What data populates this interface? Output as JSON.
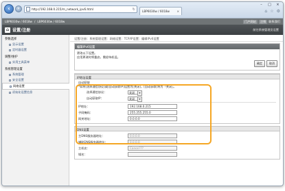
{
  "browser": {
    "url": "http://192.168.0.215/m_network_ipv6.html",
    "tab_title": "LBP6030w / 6018w",
    "controls": [
      "–",
      "□",
      "×"
    ]
  },
  "header": {
    "model": "LBP6030w / 6018w",
    "model2": "LBP6030w / 6018w",
    "right_links": [
      "门户网站",
      "注销",
      "联系我们"
    ],
    "title": "设置/注册",
    "settings_link": "前往系统管理员设置"
  },
  "sidebar": {
    "sections": [
      {
        "label": "参数选择",
        "items": [
          "显示设置",
          "定时器设置"
        ]
      },
      {
        "label": "调整/维护",
        "items": [
          "实用工具菜单"
        ]
      },
      {
        "label": "系统管理设置",
        "items": [
          "系统管理",
          "安全设置",
          "网络设置",
          "初始化设置信息"
        ]
      }
    ],
    "active_item": "网络设置"
  },
  "breadcrumb": "设置/注册：系统管理设置：网络设置：TCP/IP设置：编辑IPv6设置",
  "edit_panel": {
    "title": "编辑IPv6设置",
    "lines": [
      "更改以下设置。",
      "应用更改时将重启，需经待机设。"
    ],
    "ok": "确定",
    "cancel": "取消"
  },
  "ipv6": {
    "section_label": "IP地址设置",
    "auto_label": "自动获取",
    "note": "*如将[选择通信协议]或[自动获取IP]设置为[关闭]，[自动获取]将为「关闭」。",
    "protocol_label": "选择通信协议：",
    "protocol_value": "关闭",
    "autoip_label": "自动获取IP：",
    "autoip_value": "关闭",
    "ip_label": "IP地址：",
    "ip_value": "192.168.0.215",
    "mask_label": "子网掩码：",
    "mask_value": "255.255.255.0",
    "gw_label": "网关地址：",
    "gw_value": "0.0.0.0"
  },
  "dns": {
    "section_label": "DNS设置",
    "primary_label": "主DNS服务器地址：",
    "primary_value": "0.0.0.0",
    "secondary_label": "辅助DNS服务器地址：",
    "secondary_value": "0.0.0.0",
    "host_label": "主机名：",
    "host_value": "Canon???",
    "domain_label": "域名：",
    "domain_value": ""
  },
  "colors": {
    "highlight": "#f5a623",
    "header": "#3c4043",
    "accent": "#2a63b4"
  }
}
